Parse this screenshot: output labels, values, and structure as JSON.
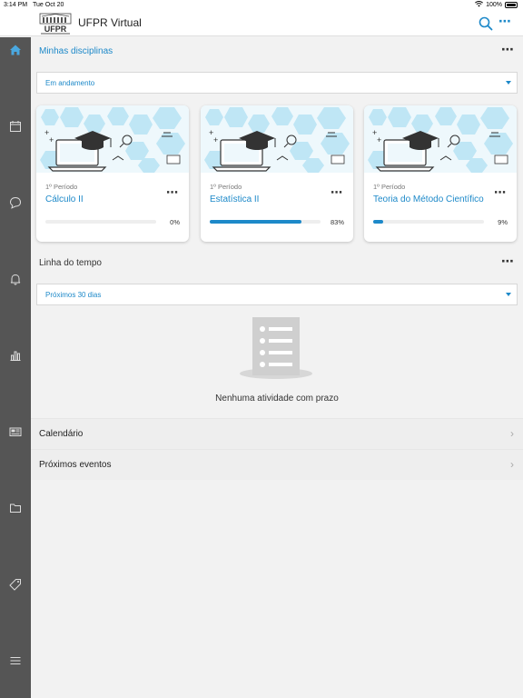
{
  "status": {
    "time": "3:14 PM",
    "date": "Tue Oct 20",
    "battery": "100%"
  },
  "header": {
    "logo_text": "UFPR",
    "title": "UFPR Virtual",
    "more": "⋯"
  },
  "sidebar": {
    "items": [
      {
        "icon": "home-icon"
      },
      {
        "icon": "calendar-icon"
      },
      {
        "icon": "chat-bubble-icon"
      },
      {
        "icon": "bell-icon"
      },
      {
        "icon": "bar-chart-icon"
      },
      {
        "icon": "news-icon"
      },
      {
        "icon": "folder-icon"
      },
      {
        "icon": "tag-icon"
      },
      {
        "icon": "hamburger-menu-icon"
      }
    ]
  },
  "courses": {
    "title": "Minhas disciplinas",
    "more": "⋯",
    "filter": "Em andamento",
    "cards": [
      {
        "period": "1º Período",
        "name": "Cálculo II",
        "progress": 0,
        "progress_label": "0%"
      },
      {
        "period": "1º Período",
        "name": "Estatística II",
        "progress": 83,
        "progress_label": "83%"
      },
      {
        "period": "1º Período",
        "name": "Teoria do Método Científico",
        "progress": 9,
        "progress_label": "9%"
      }
    ],
    "card_more": "⋯"
  },
  "timeline": {
    "title": "Linha do tempo",
    "more": "⋯",
    "filter": "Próximos 30 dias",
    "empty_text": "Nenhuma atividade com prazo"
  },
  "links": [
    {
      "label": "Calendário"
    },
    {
      "label": "Próximos eventos"
    }
  ],
  "colors": {
    "accent": "#1d89c9",
    "sidebar": "#555555",
    "background": "#f2f2f2"
  }
}
